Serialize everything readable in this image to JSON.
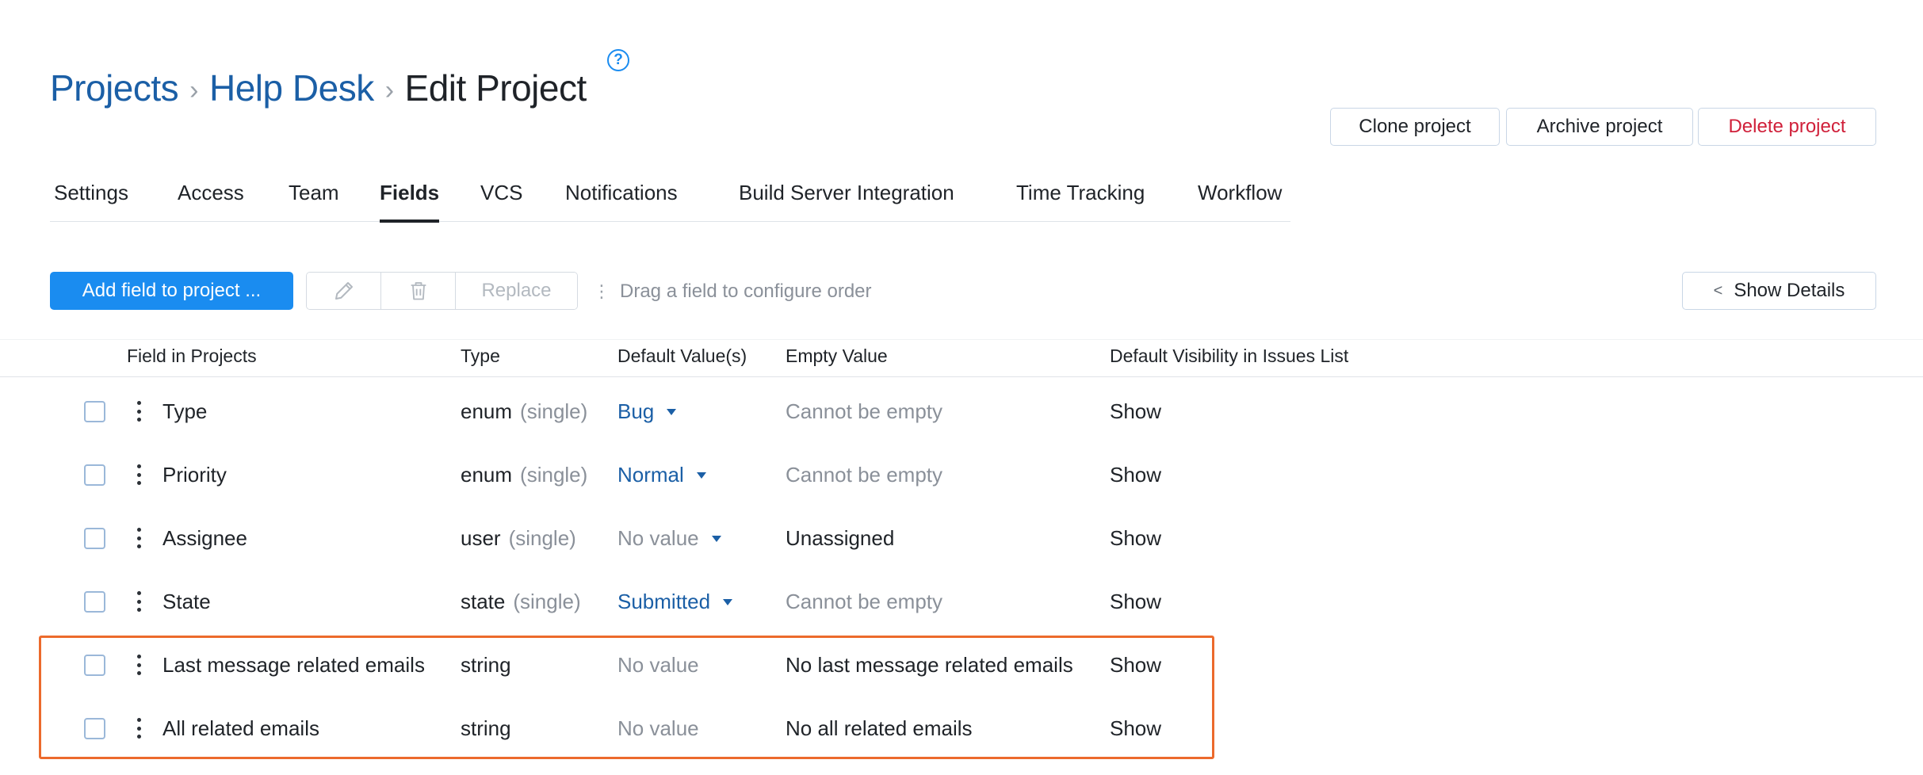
{
  "breadcrumb": {
    "items": [
      "Projects",
      "Help Desk"
    ],
    "separator": "›",
    "current": "Edit Project"
  },
  "header_actions": {
    "clone": "Clone project",
    "archive": "Archive project",
    "delete": "Delete project"
  },
  "tabs": [
    {
      "label": "Settings",
      "active": false
    },
    {
      "label": "Access",
      "active": false
    },
    {
      "label": "Team",
      "active": false
    },
    {
      "label": "Fields",
      "active": true
    },
    {
      "label": "VCS",
      "active": false
    },
    {
      "label": "Notifications",
      "active": false
    },
    {
      "label": "Build Server Integration",
      "active": false
    },
    {
      "label": "Time Tracking",
      "active": false
    },
    {
      "label": "Workflow",
      "active": false
    }
  ],
  "toolbar": {
    "add_label": "Add field to project ...",
    "replace_label": "Replace",
    "drag_hint": "Drag a field to configure order",
    "details_label": "Show Details"
  },
  "table": {
    "headers": [
      "Field in Projects",
      "Type",
      "Default Value(s)",
      "Empty Value",
      "Default Visibility in Issues List"
    ],
    "rows": [
      {
        "field": "Type",
        "type": "enum",
        "type_note": "(single)",
        "default": "Bug",
        "default_kind": "link",
        "empty": "Cannot be empty",
        "empty_muted": true,
        "visibility": "Show"
      },
      {
        "field": "Priority",
        "type": "enum",
        "type_note": "(single)",
        "default": "Normal",
        "default_kind": "link",
        "empty": "Cannot be empty",
        "empty_muted": true,
        "visibility": "Show"
      },
      {
        "field": "Assignee",
        "type": "user",
        "type_note": "(single)",
        "default": "No value",
        "default_kind": "muted-dropdown",
        "empty": "Unassigned",
        "empty_muted": false,
        "visibility": "Show"
      },
      {
        "field": "State",
        "type": "state",
        "type_note": "(single)",
        "default": "Submitted",
        "default_kind": "link",
        "empty": "Cannot be empty",
        "empty_muted": true,
        "visibility": "Show"
      },
      {
        "field": "Last message related emails",
        "type": "string",
        "type_note": "",
        "default": "No value",
        "default_kind": "muted",
        "empty": "No last message related emails",
        "empty_muted": false,
        "visibility": "Show"
      },
      {
        "field": "All related emails",
        "type": "string",
        "type_note": "",
        "default": "No value",
        "default_kind": "muted",
        "empty": "No all related emails",
        "empty_muted": false,
        "visibility": "Show"
      }
    ]
  },
  "colors": {
    "primary": "#1a8cf0",
    "link": "#1b5fa6",
    "danger": "#d0203a",
    "highlight": "#ec6a2c"
  },
  "icons": {
    "help": "help-icon",
    "edit": "pencil-icon",
    "delete": "trash-icon",
    "drag": "drag-handle-icon",
    "details": "chevron-left-icon"
  }
}
